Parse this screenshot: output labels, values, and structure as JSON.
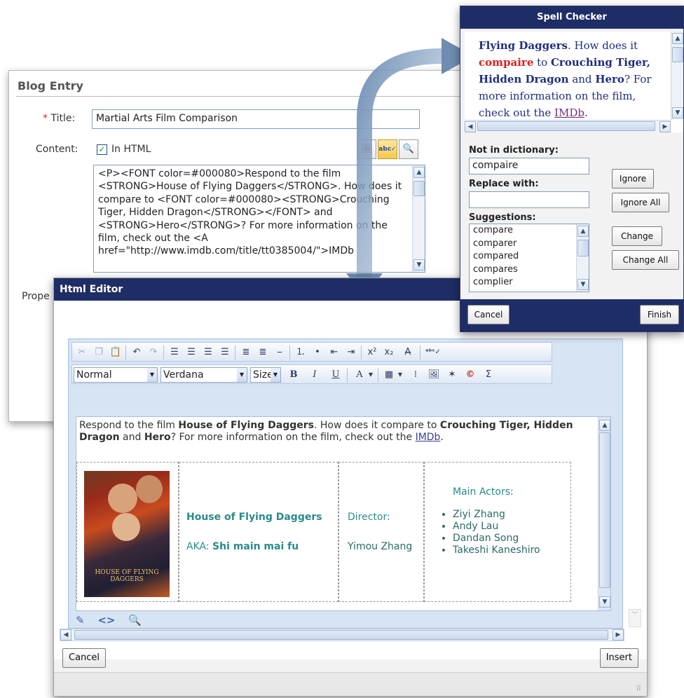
{
  "blog": {
    "title": "Blog Entry",
    "required_mark": "*",
    "title_label": "Title:",
    "title_value": "Martial Arts Film Comparison",
    "content_label": "Content:",
    "in_html_label": "In HTML",
    "in_html_checked": "✓",
    "properties_label": "Prope",
    "html_source": "<P><FONT color=#000080>Respond to the film <STRONG>House of Flying Daggers</STRONG>. How does it compare to <FONT color=#000080><STRONG>Crouching Tiger, Hidden Dragon</STRONG></FONT> and <STRONG>Hero</STRONG>? For more information on the film, check out the <A href=\"http://www.imdb.com/title/tt0385004/\">IMDb"
  },
  "editor": {
    "title": "Html Editor",
    "style_select": "Normal",
    "font_select": "Verdana",
    "size_select": "Size",
    "toolbar_text": {
      "bold": "B",
      "italic": "I",
      "underline": "U",
      "font_color": "A",
      "sigma": "Σ",
      "copyright": "©"
    },
    "content": {
      "p1_a": "Respond to the film ",
      "p1_b": "House of Flying Daggers",
      "p1_c": ". How does it compare to ",
      "p1_d": "Crouching Tiger, Hidden Dragon",
      "p1_e": " and ",
      "p1_f": "Hero",
      "p1_g": "? For more information on the film, check out the ",
      "p1_link": "IMDb",
      "p1_h": "."
    },
    "table": {
      "poster_caption": "HOUSE OF FLYING DAGGERS",
      "film_title": "House of Flying Daggers",
      "aka_label": "AKA: ",
      "aka_value": "Shi main mai fu",
      "director_label": "Director:",
      "director_value": "Yimou Zhang",
      "actors_label": "Main Actors:",
      "actors": [
        "Ziyi Zhang",
        "Andy Lau",
        "Dandan Song",
        "Takeshi Kaneshiro"
      ]
    },
    "cancel_label": "Cancel",
    "insert_label": "Insert"
  },
  "spell": {
    "title": "Spell Checker",
    "preview": {
      "a": "Flying Daggers",
      "b": ". How does it ",
      "misspelled": "compaire",
      "c": " to ",
      "d": "Crouching Tiger, Hidden Dragon",
      "e": " and ",
      "f": "Hero",
      "g": "? For more information on the film, check out the ",
      "link": "IMDb",
      "h": "."
    },
    "not_in_dict_label": "Not in dictionary:",
    "not_in_dict_value": "compaire",
    "replace_label": "Replace with:",
    "replace_value": "",
    "suggestions_label": "Suggestions:",
    "suggestions": [
      "compare",
      "comparer",
      "compared",
      "compares",
      "complier"
    ],
    "ignore_label": "Ignore",
    "ignore_all_label": "Ignore All",
    "change_label": "Change",
    "change_all_label": "Change All",
    "cancel_label": "Cancel",
    "finish_label": "Finish"
  },
  "colors": {
    "dialog_header": "#1f2d66",
    "misspelled": "#d91f1f",
    "accent_teal": "#2a8a8a"
  }
}
